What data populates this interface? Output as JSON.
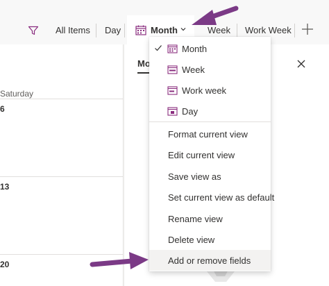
{
  "commandbar": {
    "filter_icon": "filter-icon",
    "items": {
      "all_items": "All Items",
      "day": "Day",
      "month": "Month",
      "week": "Week",
      "work_week": "Work Week"
    },
    "add_view_icon": "plus-icon",
    "accent": "#8a2d7f"
  },
  "calendar": {
    "day_header": "Saturday",
    "dates": [
      "6",
      "13",
      "20"
    ]
  },
  "panel": {
    "title": "Mo",
    "close_icon": "close-icon"
  },
  "view_menu": {
    "selected": "Month",
    "views": [
      {
        "label": "Month",
        "icon": "calendar-icon",
        "checked": true
      },
      {
        "label": "Week",
        "icon": "calendar-icon",
        "checked": false
      },
      {
        "label": "Work week",
        "icon": "calendar-icon",
        "checked": false
      },
      {
        "label": "Day",
        "icon": "calendar-icon",
        "checked": false
      }
    ],
    "actions": [
      {
        "label": "Format current view"
      },
      {
        "label": "Edit current view"
      },
      {
        "label": "Save view as"
      },
      {
        "label": "Set current view as default"
      },
      {
        "label": "Rename view"
      },
      {
        "label": "Delete view"
      },
      {
        "label": "Add or remove fields",
        "highlighted": true
      }
    ]
  },
  "annotation": {
    "arrow_color": "#7b3a86"
  }
}
